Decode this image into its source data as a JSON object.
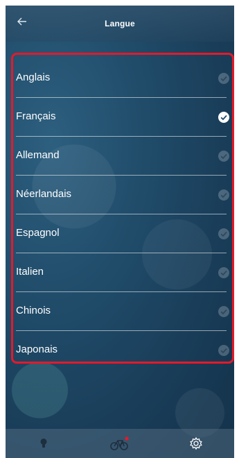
{
  "header": {
    "title": "Langue"
  },
  "languages": [
    {
      "label": "Anglais",
      "selected": false
    },
    {
      "label": "Français",
      "selected": true
    },
    {
      "label": "Allemand",
      "selected": false
    },
    {
      "label": "Néerlandais",
      "selected": false
    },
    {
      "label": "Espagnol",
      "selected": false
    },
    {
      "label": "Italien",
      "selected": false
    },
    {
      "label": "Chinois",
      "selected": false
    },
    {
      "label": "Japonais",
      "selected": false
    }
  ],
  "tabbar": {
    "tabs": [
      {
        "icon": "bulb-icon"
      },
      {
        "icon": "bike-icon",
        "badge": true
      },
      {
        "icon": "gear-icon"
      }
    ]
  },
  "colors": {
    "highlight_border": "#e5192a",
    "badge": "#e5192a"
  }
}
